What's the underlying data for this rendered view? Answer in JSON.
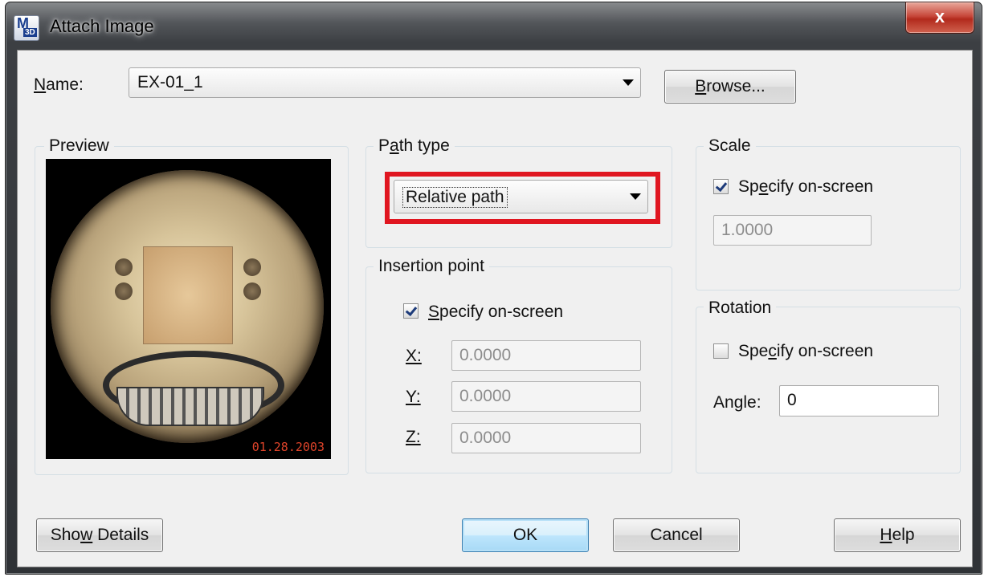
{
  "window": {
    "title": "Attach Image",
    "close_symbol": "x",
    "app_icon": {
      "main": "M",
      "sub": "3D"
    }
  },
  "name_row": {
    "label": "Name:",
    "value": "EX-01_1",
    "browse_label": "Browse..."
  },
  "preview": {
    "title": "Preview",
    "date_stamp": "01.28.2003"
  },
  "path_type": {
    "title": "Path type",
    "selected": "Relative path"
  },
  "insertion_point": {
    "title": "Insertion point",
    "specify_label": "Specify on-screen",
    "specify_checked": true,
    "x_label": "X:",
    "y_label": "Y:",
    "z_label": "Z:",
    "x_value": "0.0000",
    "y_value": "0.0000",
    "z_value": "0.0000"
  },
  "scale": {
    "title": "Scale",
    "specify_label": "Specify on-screen",
    "specify_checked": true,
    "value": "1.0000"
  },
  "rotation": {
    "title": "Rotation",
    "specify_label": "Specify on-screen",
    "specify_checked": false,
    "angle_label": "Angle:",
    "angle_value": "0"
  },
  "buttons": {
    "show_details": "Show Details",
    "ok": "OK",
    "cancel": "Cancel",
    "help": "Help"
  },
  "colors": {
    "highlight": "#e01620",
    "window_frame": "#3c3f43",
    "dialog_bg": "#f0f0f0"
  },
  "icons": [
    "app-icon",
    "close-icon",
    "chevron-down-icon",
    "checkbox-checked-icon",
    "checkbox-unchecked-icon"
  ]
}
